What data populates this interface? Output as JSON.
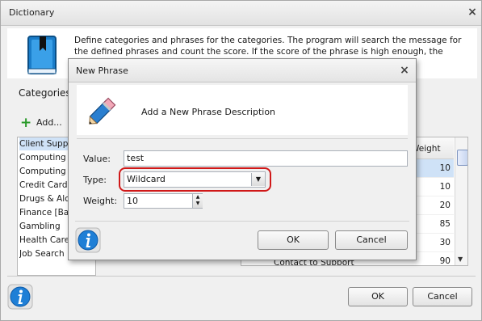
{
  "dictionary_window": {
    "title": "Dictionary",
    "close_glyph": "×",
    "description": "Define categories and phrases for the categories. The program will search the message for the defined phrases and count the score. If the score of the phrase is high enough, the message will",
    "categories_label": "Categories",
    "add_button_label": "Add...",
    "categories": [
      {
        "label": "Client Support",
        "selected": true
      },
      {
        "label": "Computing [Bu",
        "selected": false
      },
      {
        "label": "Computing [Ex",
        "selected": false
      },
      {
        "label": "Credit Cards",
        "selected": false
      },
      {
        "label": "Drugs & Alcoh",
        "selected": false
      },
      {
        "label": "Finance [Bank",
        "selected": false
      },
      {
        "label": "Gambling",
        "selected": false
      },
      {
        "label": "Health Care",
        "selected": false
      },
      {
        "label": "Job Search",
        "selected": false
      }
    ],
    "weight_column_header": "Weight",
    "weights": [
      {
        "value": "10",
        "selected": true
      },
      {
        "value": "10",
        "selected": false
      },
      {
        "value": "20",
        "selected": false
      },
      {
        "value": "85",
        "selected": false
      },
      {
        "value": "30",
        "selected": false
      },
      {
        "value": "90",
        "selected": false
      }
    ],
    "last_row_phrase": "Contact to Support",
    "ok_label": "OK",
    "cancel_label": "Cancel",
    "icons": [
      "book-icon",
      "info-icon",
      "plus-icon",
      "close-icon"
    ]
  },
  "new_phrase_dialog": {
    "title": "New Phrase",
    "close_glyph": "×",
    "header_text": "Add a New Phrase Description",
    "value_label": "Value:",
    "value": "test",
    "type_label": "Type:",
    "type_value": "Wildcard",
    "weight_label": "Weight:",
    "weight_value": "10",
    "ok_label": "OK",
    "cancel_label": "Cancel",
    "icons": [
      "pencil-icon",
      "info-icon",
      "close-icon",
      "dropdown-arrow-icon"
    ],
    "highlight_color": "#d01818"
  }
}
